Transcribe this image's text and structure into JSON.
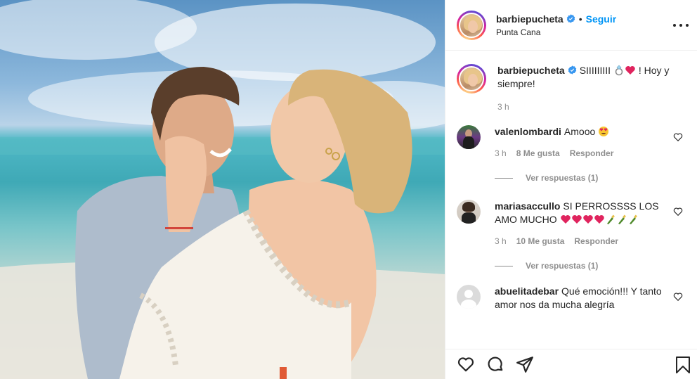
{
  "post": {
    "username": "barbiepucheta",
    "follow_label": "Seguir",
    "separator": "•",
    "location": "Punta Cana"
  },
  "caption": {
    "username": "barbiepucheta",
    "text_before": "SIIIIIIIII",
    "text_after": "! Hoy y siempre!",
    "time": "3 h"
  },
  "comments": [
    {
      "username": "valenlombardi",
      "text": "Amooo",
      "time": "3 h",
      "likes": "8 Me gusta",
      "reply_label": "Responder",
      "view_replies": "Ver respuestas (1)"
    },
    {
      "username": "mariasaccullo",
      "text": "SI PERROSSSS LOS AMO MUCHO",
      "time": "3 h",
      "likes": "10 Me gusta",
      "reply_label": "Responder",
      "view_replies": "Ver respuestas (1)"
    },
    {
      "username": "abuelitadebar",
      "text": "Qué emoción!!! Y tanto amor nos da mucha alegría"
    }
  ],
  "icons": {
    "more": "more-options-icon",
    "verified": "verified-badge-icon",
    "like": "heart-icon",
    "comment": "comment-icon",
    "share": "share-icon",
    "save": "bookmark-icon"
  },
  "colors": {
    "accent": "#0095f6",
    "muted": "#8e8e8e",
    "text": "#262626",
    "heart_red": "#e0245e"
  }
}
